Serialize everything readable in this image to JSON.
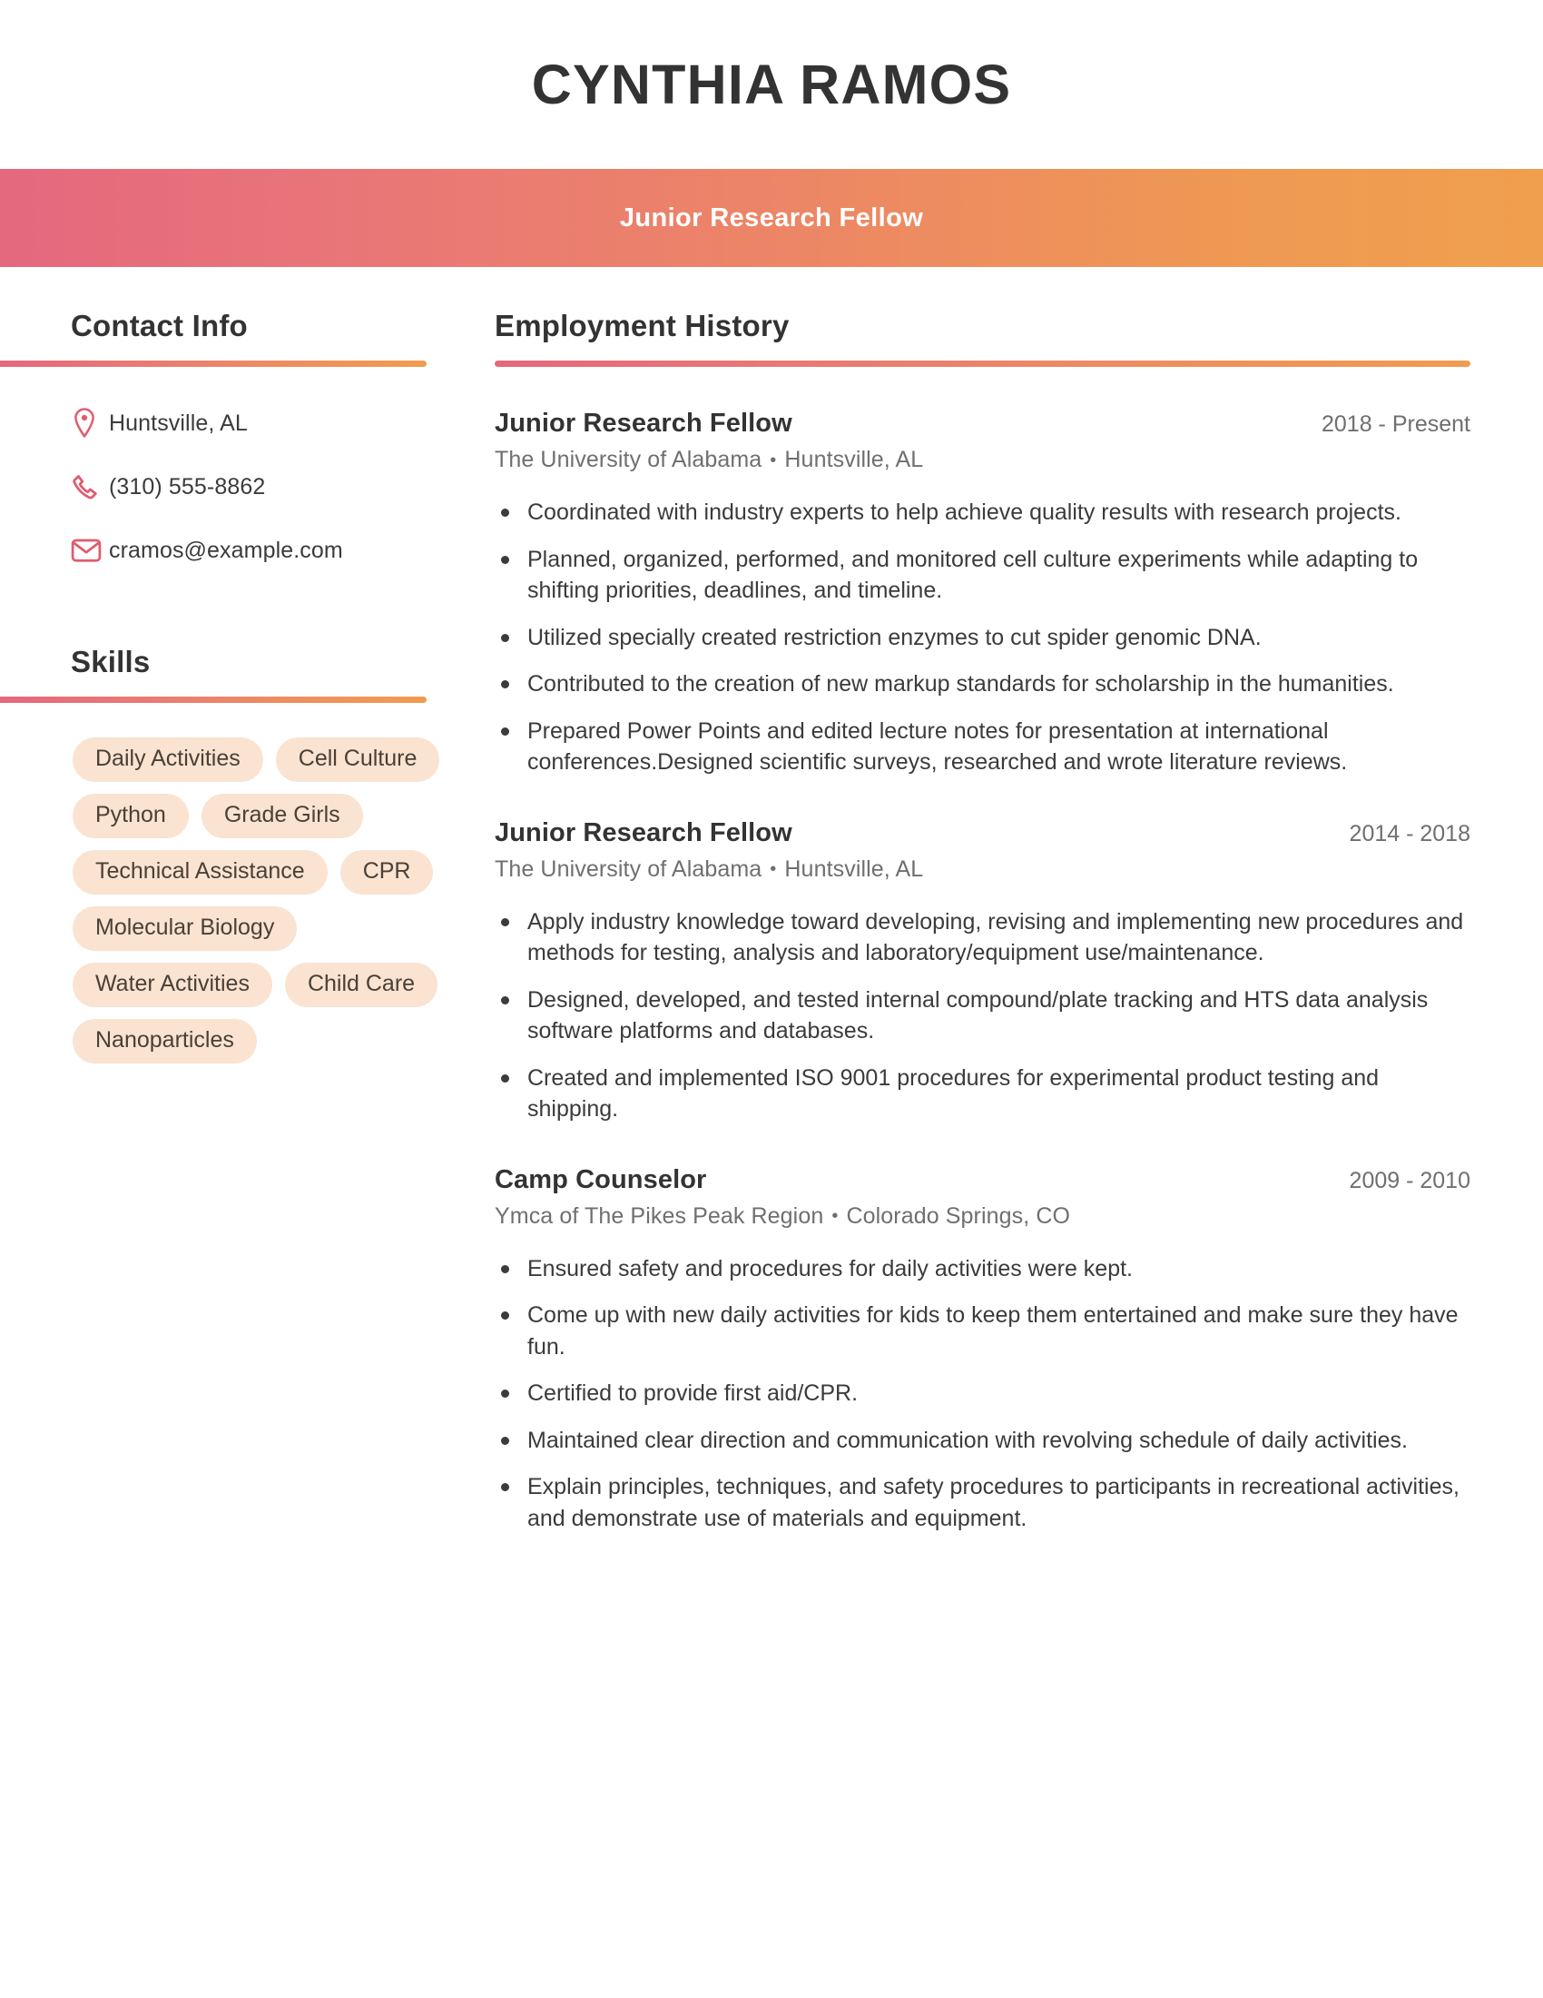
{
  "header": {
    "full_name": "CYNTHIA RAMOS",
    "job_title": "Junior Research Fellow",
    "accent_start": "#e4687e",
    "accent_end": "#f09f4e",
    "band_text_color": "#ffffff"
  },
  "sidebar": {
    "contact": {
      "heading": "Contact Info",
      "items": [
        {
          "icon": "location-pin-icon",
          "value": "Huntsville, AL"
        },
        {
          "icon": "phone-icon",
          "value": "(310) 555-8862"
        },
        {
          "icon": "envelope-icon",
          "value": "cramos@example.com"
        }
      ]
    },
    "skills": {
      "heading": "Skills",
      "pill_bg": "#fae3d1",
      "items": [
        "Daily Activities",
        "Cell Culture",
        "Python",
        "Grade Girls",
        "Technical Assistance",
        "CPR",
        "Molecular Biology",
        "Water Activities",
        "Child Care",
        "Nanoparticles"
      ]
    }
  },
  "main": {
    "employment": {
      "heading": "Employment History",
      "separator": "•",
      "jobs": [
        {
          "role": "Junior Research Fellow",
          "dates": "2018 - Present",
          "company": "The University of Alabama",
          "location": "Huntsville, AL",
          "bullets": [
            "Coordinated with industry experts to help achieve quality results with research projects.",
            "Planned, organized, performed, and monitored cell culture experiments while adapting to shifting priorities, deadlines, and timeline.",
            "Utilized specially created restriction enzymes to cut spider genomic DNA.",
            "Contributed to the creation of new markup standards for scholarship in the humanities.",
            "Prepared Power Points and edited lecture notes for presentation at international conferences.Designed scientific surveys, researched and wrote literature reviews."
          ]
        },
        {
          "role": "Junior Research Fellow",
          "dates": "2014 - 2018",
          "company": "The University of Alabama",
          "location": "Huntsville, AL",
          "bullets": [
            "Apply industry knowledge toward developing, revising and implementing new procedures and methods for testing, analysis and laboratory/equipment use/maintenance.",
            "Designed, developed, and tested internal compound/plate tracking and HTS data analysis software platforms and databases.",
            "Created and implemented ISO 9001 procedures for experimental product testing and shipping."
          ]
        },
        {
          "role": "Camp Counselor",
          "dates": "2009 - 2010",
          "company": "Ymca of The Pikes Peak Region",
          "location": "Colorado Springs, CO",
          "bullets": [
            "Ensured safety and procedures for daily activities were kept.",
            "Come up with new daily activities for kids to keep them entertained and make sure they have fun.",
            "Certified to provide first aid/CPR.",
            "Maintained clear direction and communication with revolving schedule of daily activities.",
            "Explain principles, techniques, and safety procedures to participants in recreational activities, and demonstrate use of materials and equipment."
          ]
        }
      ]
    }
  }
}
